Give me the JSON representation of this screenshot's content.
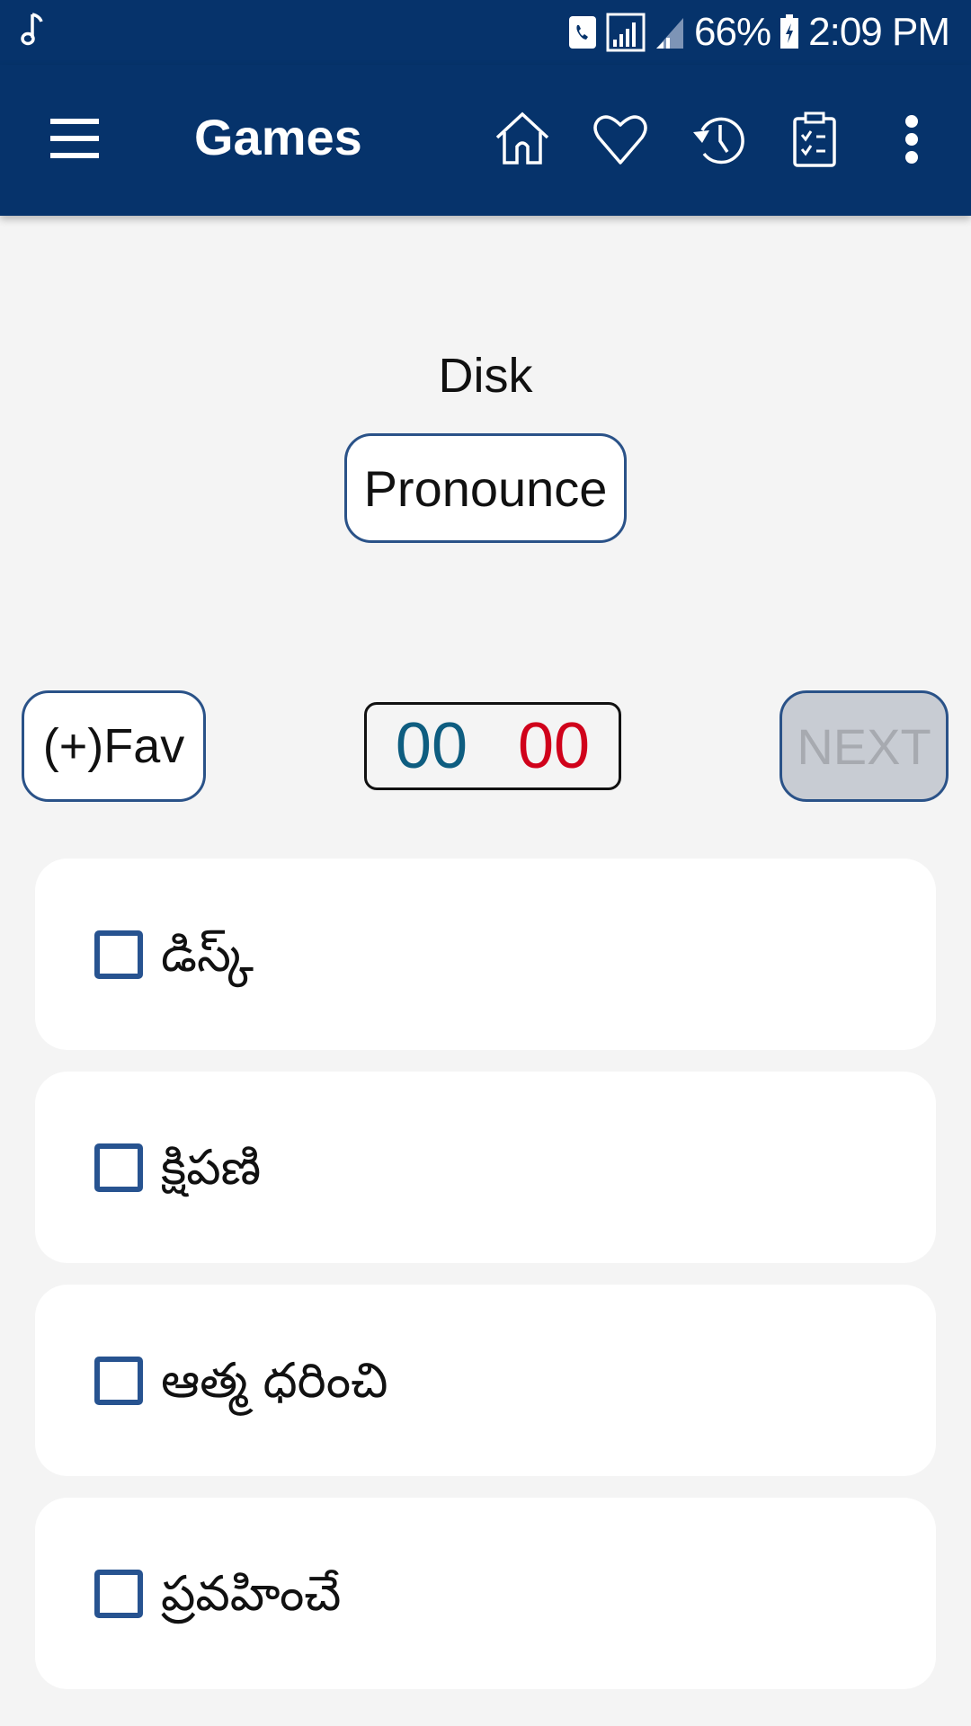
{
  "status_bar": {
    "notification_icon": "music-note-icon",
    "battery_percent": "66%",
    "time": "2:09 PM",
    "icons": [
      "wifi-calling-icon",
      "signal-icon",
      "signal-secondary-icon",
      "battery-charging-icon"
    ]
  },
  "app_bar": {
    "title": "Games",
    "actions": [
      {
        "name": "home",
        "icon": "home-icon"
      },
      {
        "name": "favorites",
        "icon": "heart-icon"
      },
      {
        "name": "history",
        "icon": "history-icon"
      },
      {
        "name": "quiz",
        "icon": "clipboard-check-icon"
      },
      {
        "name": "more",
        "icon": "more-vert-icon"
      }
    ]
  },
  "game": {
    "word": "Disk",
    "pronounce_label": "Pronounce",
    "fav_label": "(+)Fav",
    "score": {
      "correct": "00",
      "wrong": "00",
      "correct_color": "#0e5d80",
      "wrong_color": "#d0021b"
    },
    "next_label": "NEXT",
    "next_enabled": false,
    "options": [
      {
        "label": "డిస్క్",
        "checked": false
      },
      {
        "label": "క్షిపణి",
        "checked": false
      },
      {
        "label": "ఆత్మ ధరించి",
        "checked": false
      },
      {
        "label": "ప్రవహించే",
        "checked": false
      }
    ]
  },
  "colors": {
    "primary": "#06336b",
    "accent_border": "#2a5288",
    "background": "#f4f4f4"
  }
}
